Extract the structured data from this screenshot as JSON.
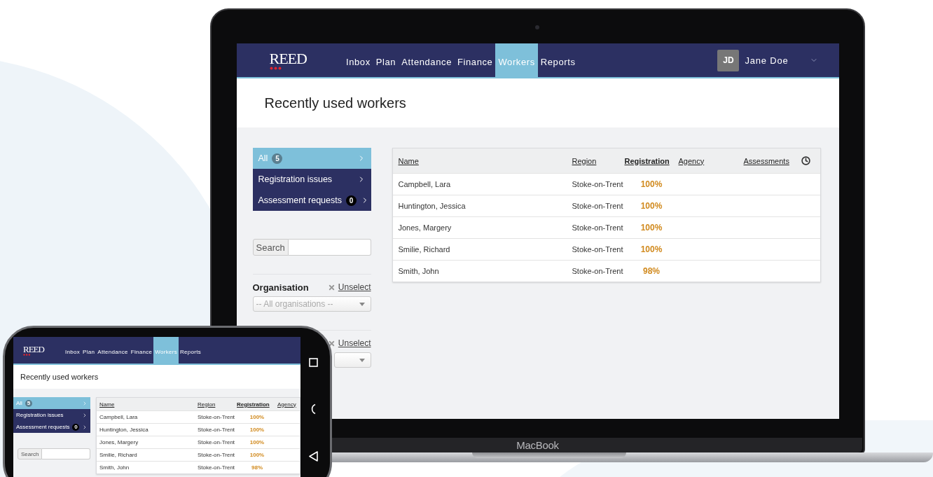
{
  "laptop": {
    "brand": "MacBook",
    "app": {
      "logo": "REED",
      "nav": [
        {
          "label": "Inbox",
          "selected": false
        },
        {
          "label": "Plan",
          "selected": false
        },
        {
          "label": "Attendance",
          "selected": false
        },
        {
          "label": "Finance",
          "selected": false
        },
        {
          "label": "Workers",
          "selected": true
        },
        {
          "label": "Reports",
          "selected": false
        }
      ],
      "user": {
        "initials": "JD",
        "name": "Jane Doe"
      },
      "page_title": "Recently used workers",
      "filters": [
        {
          "label": "All",
          "count": "5",
          "selected": true
        },
        {
          "label": "Registration issues",
          "selected": false
        },
        {
          "label": "Assessment requests",
          "count": "0",
          "selected": false
        }
      ],
      "search": {
        "label": "Search"
      },
      "filter_groups": [
        {
          "label": "Organisation",
          "unselect": "Unselect",
          "placeholder": "-- All organisations --"
        },
        {
          "unselect": "Unselect"
        }
      ],
      "table": {
        "columns": [
          {
            "kind": "text",
            "label": "Name",
            "sorted": false
          },
          {
            "kind": "text",
            "label": "Region",
            "sorted": false
          },
          {
            "kind": "text",
            "label": "Registration",
            "sorted": true
          },
          {
            "kind": "text",
            "label": "Agency",
            "sorted": false
          },
          {
            "kind": "text",
            "label": "Assessments",
            "sorted": false
          },
          {
            "kind": "icon"
          }
        ],
        "rows": [
          {
            "name": "Campbell, Lara",
            "region": "Stoke-on-Trent",
            "registration": "100%"
          },
          {
            "name": "Huntington, Jessica",
            "region": "Stoke-on-Trent",
            "registration": "100%"
          },
          {
            "name": "Jones, Margery",
            "region": "Stoke-on-Trent",
            "registration": "100%"
          },
          {
            "name": "Smilie, Richard",
            "region": "Stoke-on-Trent",
            "registration": "100%"
          },
          {
            "name": "Smith, John",
            "region": "Stoke-on-Trent",
            "registration": "98%"
          }
        ]
      }
    }
  },
  "phone": {
    "app": {
      "logo": "REED",
      "nav": [
        {
          "label": "Inbox",
          "selected": false
        },
        {
          "label": "Plan",
          "selected": false
        },
        {
          "label": "Attendance",
          "selected": false
        },
        {
          "label": "Finance",
          "selected": false
        },
        {
          "label": "Workers",
          "selected": true
        },
        {
          "label": "Reports",
          "selected": false
        }
      ],
      "page_title": "Recently used workers",
      "filters": [
        {
          "label": "All",
          "count": "5",
          "selected": true
        },
        {
          "label": "Registration issues",
          "selected": false
        },
        {
          "label": "Assessment requests",
          "count": "0",
          "selected": false
        }
      ],
      "search": {
        "label": "Search"
      },
      "table": {
        "columns": [
          {
            "kind": "text",
            "label": "Name",
            "sorted": false
          },
          {
            "kind": "text",
            "label": "Region",
            "sorted": false
          },
          {
            "kind": "text",
            "label": "Registration",
            "sorted": true
          },
          {
            "kind": "text",
            "label": "Agency",
            "sorted": false
          }
        ],
        "rows": [
          {
            "name": "Campbell, Lara",
            "region": "Stoke-on-Trent",
            "registration": "100%"
          },
          {
            "name": "Huntington, Jessica",
            "region": "Stoke-on-Trent",
            "registration": "100%"
          },
          {
            "name": "Jones, Margery",
            "region": "Stoke-on-Trent",
            "registration": "100%"
          },
          {
            "name": "Smilie, Richard",
            "region": "Stoke-on-Trent",
            "registration": "100%"
          },
          {
            "name": "Smith, John",
            "region": "Stoke-on-Trent",
            "registration": "98%"
          }
        ]
      }
    }
  }
}
